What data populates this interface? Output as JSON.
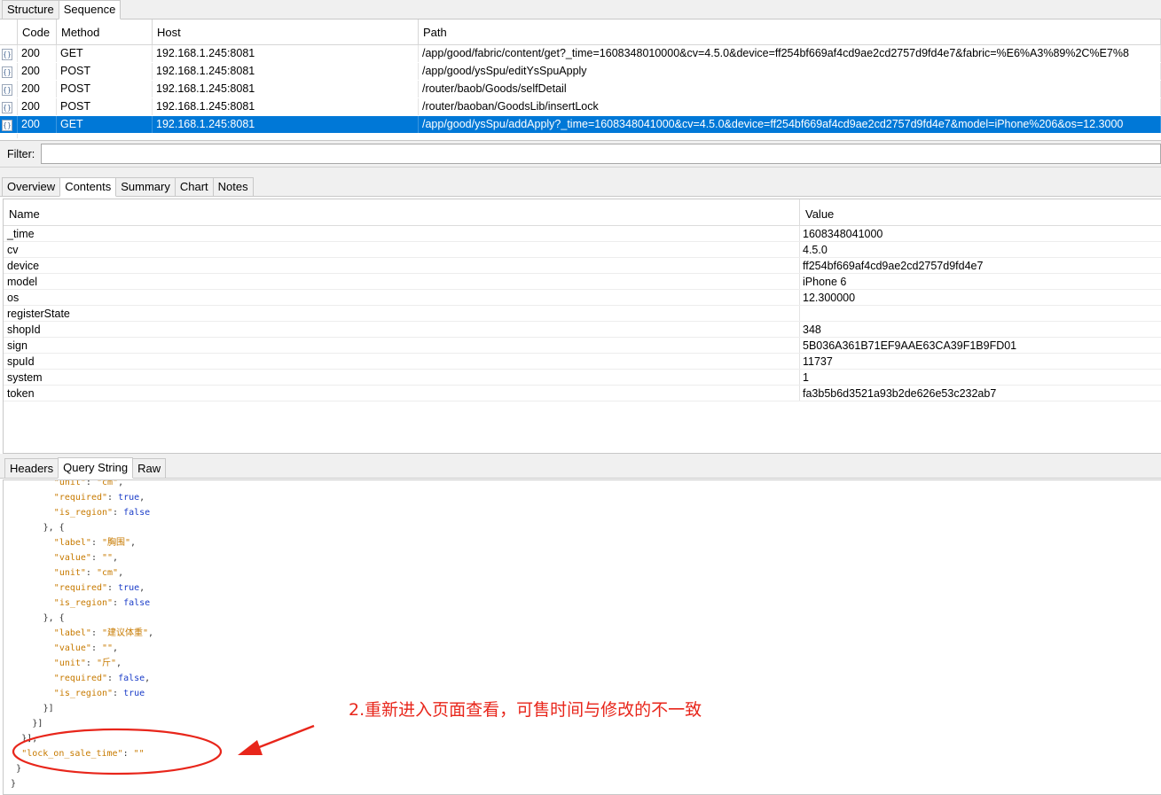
{
  "top_tabs": [
    "Structure",
    "Sequence"
  ],
  "sequence": {
    "columns": [
      "Code",
      "Method",
      "Host",
      "Path"
    ],
    "rows": [
      {
        "code": "200",
        "method": "GET",
        "host": "192.168.1.245:8081",
        "path": "/app/good/fabric/content/get?_time=1608348010000&cv=4.5.0&device=ff254bf669af4cd9ae2cd2757d9fd4e7&fabric=%E6%A3%89%2C%E7%8"
      },
      {
        "code": "200",
        "method": "POST",
        "host": "192.168.1.245:8081",
        "path": "/app/good/ysSpu/editYsSpuApply"
      },
      {
        "code": "200",
        "method": "POST",
        "host": "192.168.1.245:8081",
        "path": "/router/baob/Goods/selfDetail"
      },
      {
        "code": "200",
        "method": "POST",
        "host": "192.168.1.245:8081",
        "path": "/router/baoban/GoodsLib/insertLock"
      },
      {
        "code": "200",
        "method": "GET",
        "host": "192.168.1.245:8081",
        "path": "/app/good/ysSpu/addApply?_time=1608348041000&cv=4.5.0&device=ff254bf669af4cd9ae2cd2757d9fd4e7&model=iPhone%206&os=12.3000"
      }
    ],
    "selected_index": 4
  },
  "filter": {
    "label": "Filter:",
    "value": ""
  },
  "mid_tabs": [
    "Overview",
    "Contents",
    "Summary",
    "Chart",
    "Notes"
  ],
  "contents": {
    "columns": [
      "Name",
      "Value"
    ],
    "rows": [
      {
        "name": "_time",
        "value": "1608348041000"
      },
      {
        "name": "cv",
        "value": "4.5.0"
      },
      {
        "name": "device",
        "value": "ff254bf669af4cd9ae2cd2757d9fd4e7"
      },
      {
        "name": "model",
        "value": "iPhone 6"
      },
      {
        "name": "os",
        "value": "12.300000"
      },
      {
        "name": "registerState",
        "value": ""
      },
      {
        "name": "shopId",
        "value": "348"
      },
      {
        "name": "sign",
        "value": "5B036A361B71EF9AAE63CA39F1B9FD01"
      },
      {
        "name": "spuId",
        "value": "11737"
      },
      {
        "name": "system",
        "value": "1"
      },
      {
        "name": "token",
        "value": "fa3b5b6d3521a93b2de626e53c232ab7"
      }
    ]
  },
  "bottom_tabs": [
    "Headers",
    "Query String",
    "Raw"
  ],
  "code_lines": [
    {
      "indent": 8,
      "key": "\"unit\"",
      "sep": ": ",
      "val": "\"cm\"",
      "vt": "str",
      "tail": ","
    },
    {
      "indent": 8,
      "key": "\"required\"",
      "sep": ": ",
      "val": "true",
      "vt": "kw",
      "tail": ","
    },
    {
      "indent": 8,
      "key": "\"is_region\"",
      "sep": ": ",
      "val": "false",
      "vt": "kw",
      "tail": ""
    },
    {
      "indent": 6,
      "text": "}, {"
    },
    {
      "indent": 8,
      "key": "\"label\"",
      "sep": ": ",
      "val": "\"胸围\"",
      "vt": "str",
      "tail": ","
    },
    {
      "indent": 8,
      "key": "\"value\"",
      "sep": ": ",
      "val": "\"\"",
      "vt": "str",
      "tail": ","
    },
    {
      "indent": 8,
      "key": "\"unit\"",
      "sep": ": ",
      "val": "\"cm\"",
      "vt": "str",
      "tail": ","
    },
    {
      "indent": 8,
      "key": "\"required\"",
      "sep": ": ",
      "val": "true",
      "vt": "kw",
      "tail": ","
    },
    {
      "indent": 8,
      "key": "\"is_region\"",
      "sep": ": ",
      "val": "false",
      "vt": "kw",
      "tail": ""
    },
    {
      "indent": 6,
      "text": "}, {"
    },
    {
      "indent": 8,
      "key": "\"label\"",
      "sep": ": ",
      "val": "\"建议体重\"",
      "vt": "str",
      "tail": ","
    },
    {
      "indent": 8,
      "key": "\"value\"",
      "sep": ": ",
      "val": "\"\"",
      "vt": "str",
      "tail": ","
    },
    {
      "indent": 8,
      "key": "\"unit\"",
      "sep": ": ",
      "val": "\"斤\"",
      "vt": "str",
      "tail": ","
    },
    {
      "indent": 8,
      "key": "\"required\"",
      "sep": ": ",
      "val": "false",
      "vt": "kw",
      "tail": ","
    },
    {
      "indent": 8,
      "key": "\"is_region\"",
      "sep": ": ",
      "val": "true",
      "vt": "kw",
      "tail": ""
    },
    {
      "indent": 6,
      "text": "}]"
    },
    {
      "indent": 4,
      "text": "}]"
    },
    {
      "indent": 2,
      "text": "}],"
    },
    {
      "indent": 2,
      "key": "\"lock_on_sale_time\"",
      "sep": ": ",
      "val": "\"\"",
      "vt": "str",
      "tail": ""
    },
    {
      "indent": 1,
      "text": "}"
    },
    {
      "indent": 0,
      "text": "}"
    }
  ],
  "annotation": {
    "text": "2.重新进入页面查看，可售时间与修改的不一致",
    "color": "#e8261b"
  }
}
